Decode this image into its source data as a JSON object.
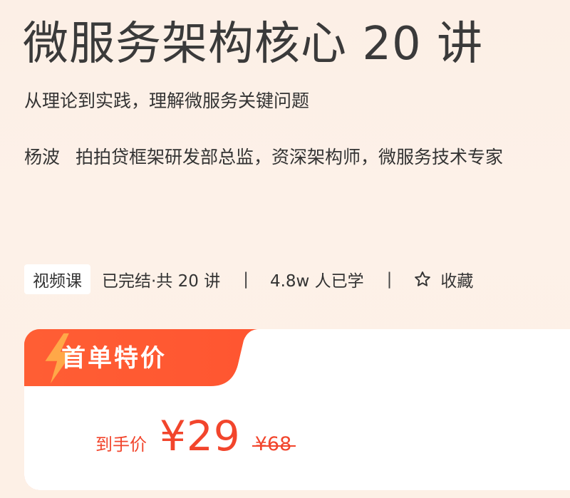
{
  "course": {
    "title": "微服务架构核心 20 讲",
    "subtitle": "从理论到实践，理解微服务关键问题",
    "author_name": "杨波",
    "author_bio": "拍拍贷框架研发部总监，资深架构师，微服务技术专家"
  },
  "meta": {
    "tag": "视频课",
    "status": "已完结·共 20 讲",
    "separator": "|",
    "learners": "4.8w 人已学",
    "favorite_label": "收藏",
    "favorite_icon": "star-outline-icon"
  },
  "promo": {
    "badge": "首单特价",
    "badge_icon": "lightning-icon",
    "price_label": "到手价",
    "price_now": "¥29",
    "price_original": "¥68",
    "accent_color": "#f2452c",
    "band_color": "#ff5b33"
  }
}
